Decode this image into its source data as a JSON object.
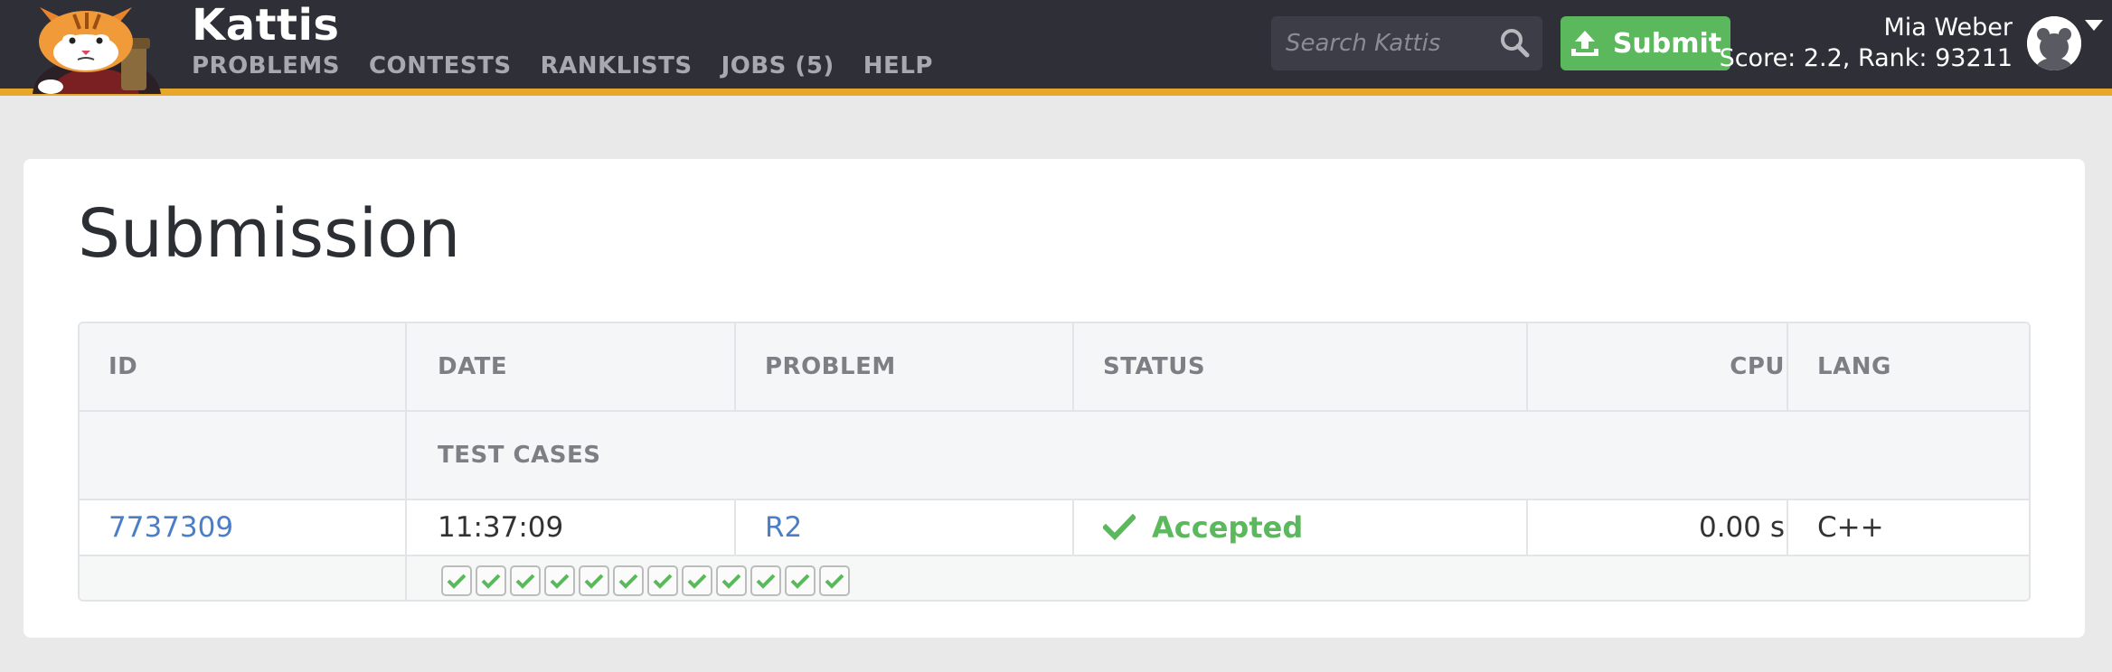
{
  "header": {
    "brand": "Kattis",
    "nav": [
      "PROBLEMS",
      "CONTESTS",
      "RANKLISTS",
      "JOBS (5)",
      "HELP"
    ],
    "search_placeholder": "Search Kattis",
    "submit_label": "Submit",
    "user_name": "Mia Weber",
    "user_score": "Score: 2.2, Rank: 93211",
    "accent_color": "#e6a72a",
    "submit_color": "#5cb85c"
  },
  "page": {
    "title": "Submission"
  },
  "submission_table": {
    "headers": {
      "id": "ID",
      "date": "DATE",
      "problem": "PROBLEM",
      "status": "STATUS",
      "cpu": "CPU",
      "lang": "LANG",
      "test_cases": "TEST CASES"
    },
    "row": {
      "id": "7737309",
      "date": "11:37:09",
      "problem": "R2",
      "status": "Accepted",
      "cpu": "0.00 s",
      "lang": "C++"
    },
    "test_cases": [
      {
        "result": "accepted"
      },
      {
        "result": "accepted"
      },
      {
        "result": "accepted"
      },
      {
        "result": "accepted"
      },
      {
        "result": "accepted"
      },
      {
        "result": "accepted"
      },
      {
        "result": "accepted"
      },
      {
        "result": "accepted"
      },
      {
        "result": "accepted"
      },
      {
        "result": "accepted"
      },
      {
        "result": "accepted"
      },
      {
        "result": "accepted"
      }
    ],
    "status_color": "#5cb85c"
  }
}
